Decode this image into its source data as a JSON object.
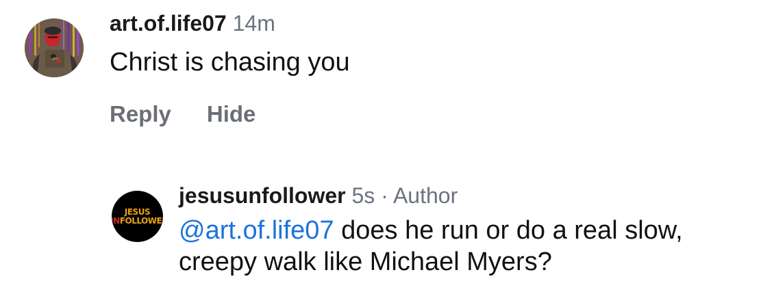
{
  "comments": [
    {
      "username": "art.of.life07",
      "time": "14m",
      "text": "Christ is chasing you",
      "actions": {
        "reply": "Reply",
        "hide": "Hide"
      }
    },
    {
      "username": "jesusunfollower",
      "time": "5s",
      "separator": "·",
      "badge": "Author",
      "mention": "@art.of.life07",
      "text_line1": "does he run or do a real slow,",
      "text_line2": "creepy walk like Michael Myers?",
      "logo": {
        "line1": "JESUS",
        "line2_red": "UN",
        "line2_gold": "FOLLOWER"
      }
    }
  ],
  "colors": {
    "mention": "#1d72d8",
    "meta_gray": "#6b7280",
    "logo_gold": "#e8a21a",
    "logo_red": "#d12a1e"
  }
}
